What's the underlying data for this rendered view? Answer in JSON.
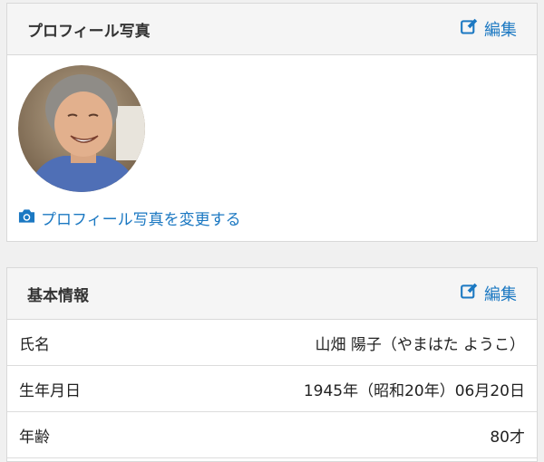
{
  "profile_photo_card": {
    "title": "プロフィール写真",
    "edit_label": "編集",
    "change_photo_label": "プロフィール写真を変更する"
  },
  "basic_info_card": {
    "title": "基本情報",
    "edit_label": "編集",
    "rows": [
      {
        "label": "氏名",
        "value": "山畑 陽子（やまはた ようこ）"
      },
      {
        "label": "生年月日",
        "value": "1945年（昭和20年）06月20日"
      },
      {
        "label": "年齢",
        "value": "80才"
      }
    ]
  },
  "colors": {
    "accent": "#1b78c2",
    "header_bg": "#f5f5f5",
    "border": "#d9d9d9"
  },
  "icons": {
    "edit": "edit-icon",
    "camera": "camera-icon"
  }
}
